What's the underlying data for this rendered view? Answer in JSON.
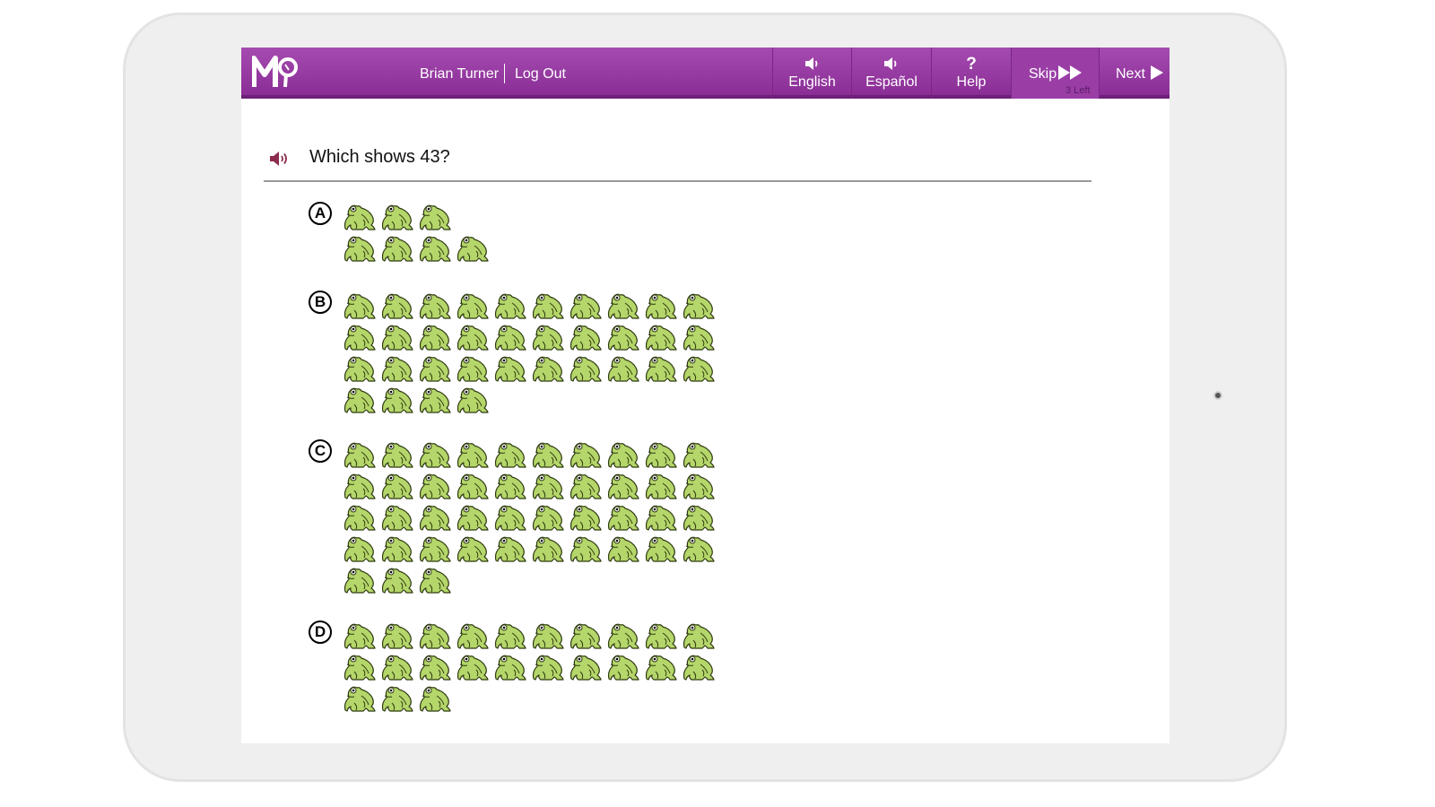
{
  "header": {
    "logo_icon": "mo-logo",
    "user_name": "Brian Turner",
    "logout_label": "Log Out",
    "buttons": {
      "english": {
        "label": "English",
        "icon": "speaker-icon"
      },
      "espanol": {
        "label": "Español",
        "icon": "speaker-icon"
      },
      "help": {
        "label": "Help",
        "icon": "?"
      },
      "skip": {
        "label": "Skip",
        "icon": "double-arrow-icon",
        "remaining": "3 Left"
      },
      "next": {
        "label": "Next",
        "icon": "play-arrow-icon"
      }
    }
  },
  "question": {
    "text": "Which shows 43?",
    "speaker_icon": "speaker-icon"
  },
  "options": [
    {
      "letter": "A",
      "frog_count": 7
    },
    {
      "letter": "B",
      "frog_count": 34
    },
    {
      "letter": "C",
      "frog_count": 43
    },
    {
      "letter": "D",
      "frog_count": 23
    }
  ],
  "colors": {
    "header_purple": "#93369f",
    "skip_bg": "#9a3ea6",
    "frog_green": "#b5d66a",
    "speaker_color": "#8b2c4e"
  }
}
